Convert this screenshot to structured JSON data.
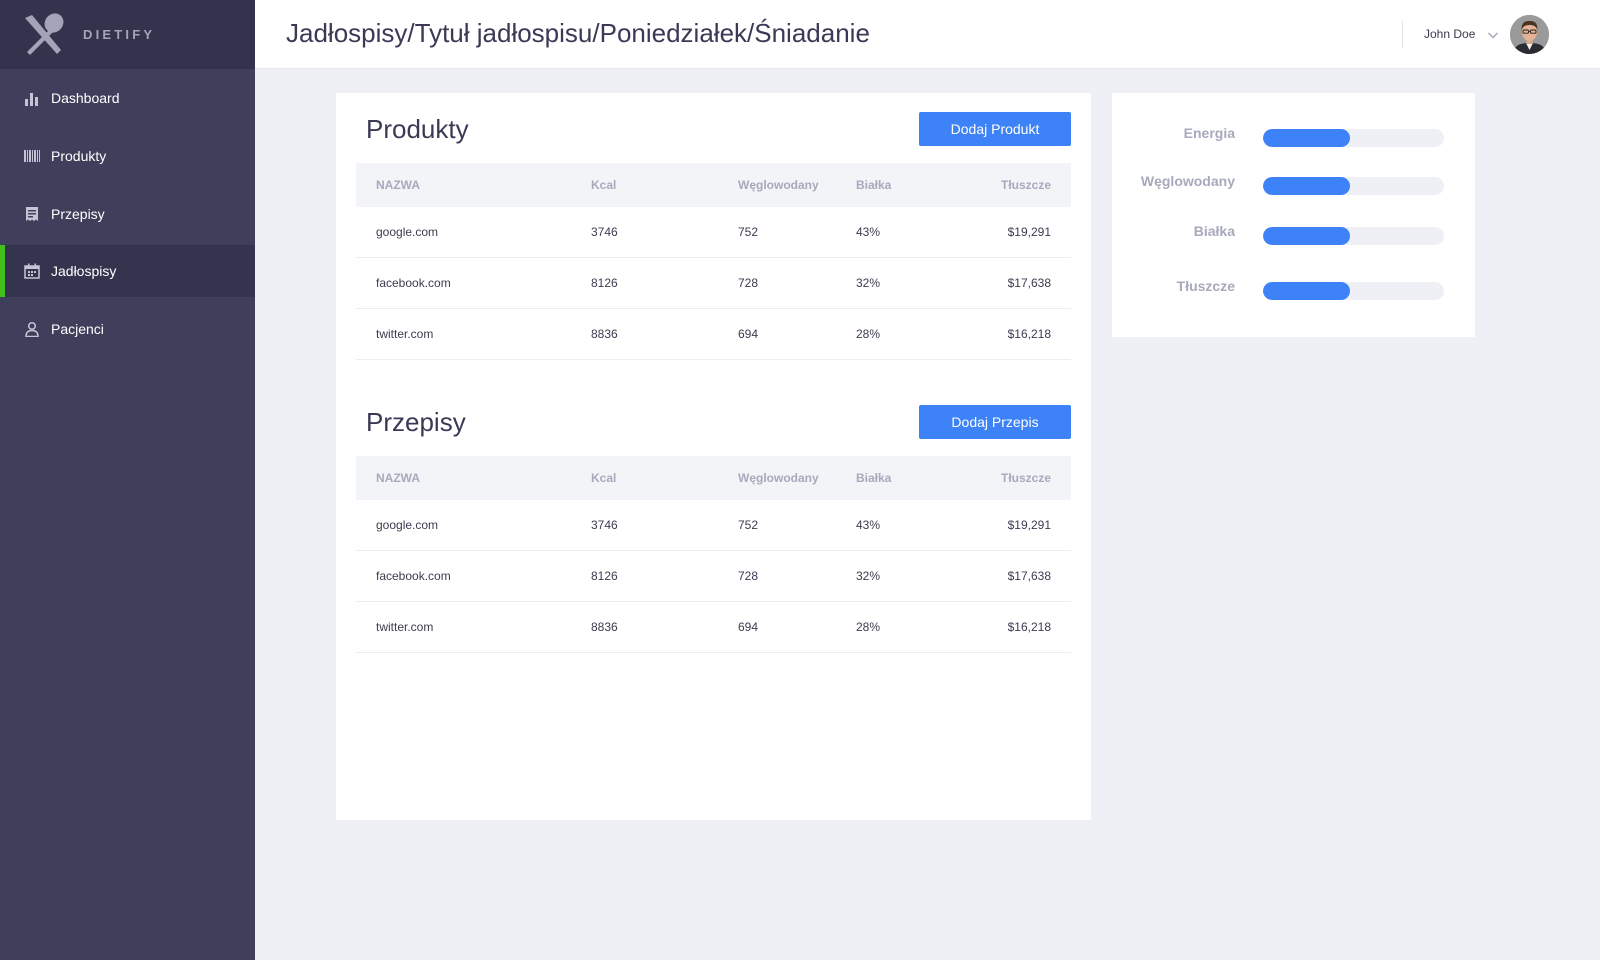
{
  "app": {
    "name": "DIETIFY"
  },
  "sidebar": {
    "items": [
      {
        "label": "Dashboard",
        "icon": "bar-chart-icon"
      },
      {
        "label": "Produkty",
        "icon": "barcode-icon"
      },
      {
        "label": "Przepisy",
        "icon": "receipt-icon"
      },
      {
        "label": "Jadłospisy",
        "icon": "calendar-icon",
        "active": true
      },
      {
        "label": "Pacjenci",
        "icon": "user-icon"
      }
    ]
  },
  "header": {
    "breadcrumb": "Jadłospisy/Tytuł jadłospisu/Poniedziałek/Śniadanie",
    "user": "John Doe"
  },
  "products": {
    "title": "Produkty",
    "add_label": "Dodaj Produkt",
    "columns": [
      "NAZWA",
      "Kcal",
      "Węglowodany",
      "Białka",
      "Tłuszcze"
    ],
    "rows": [
      [
        "google.com",
        "3746",
        "752",
        "43%",
        "$19,291"
      ],
      [
        "facebook.com",
        "8126",
        "728",
        "32%",
        "$17,638"
      ],
      [
        "twitter.com",
        "8836",
        "694",
        "28%",
        "$16,218"
      ]
    ]
  },
  "recipes": {
    "title": "Przepisy",
    "add_label": "Dodaj Przepis",
    "columns": [
      "NAZWA",
      "Kcal",
      "Węglowodany",
      "Białka",
      "Tłuszcze"
    ],
    "rows": [
      [
        "google.com",
        "3746",
        "752",
        "43%",
        "$19,291"
      ],
      [
        "facebook.com",
        "8126",
        "728",
        "32%",
        "$17,638"
      ],
      [
        "twitter.com",
        "8836",
        "694",
        "28%",
        "$16,218"
      ]
    ]
  },
  "macros": [
    {
      "label": "Energia",
      "fraction": 0.48
    },
    {
      "label": "Węglowodany",
      "fraction": 0.48
    },
    {
      "label": "Białka",
      "fraction": 0.48
    },
    {
      "label": "Tłuszcze",
      "fraction": 0.48
    }
  ],
  "colors": {
    "accent": "#3d82f6",
    "active_marker": "#42c01a",
    "sidebar": "#3f3f5c"
  }
}
